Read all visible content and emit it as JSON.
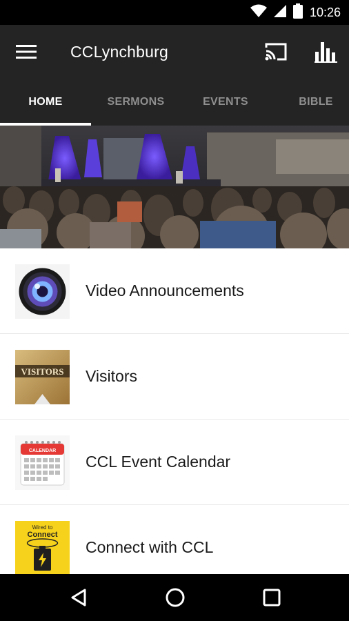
{
  "status_bar": {
    "time": "10:26"
  },
  "app_bar": {
    "title": "CCLynchburg"
  },
  "tabs": [
    {
      "label": "HOME",
      "active": true
    },
    {
      "label": "SERMONS",
      "active": false
    },
    {
      "label": "EVENTS",
      "active": false
    },
    {
      "label": "BIBLE",
      "active": false
    }
  ],
  "list": {
    "items": [
      {
        "label": "Video Announcements",
        "icon": "camera-lens-icon"
      },
      {
        "label": "Visitors",
        "icon": "visitors-banner-icon"
      },
      {
        "label": "CCL Event Calendar",
        "icon": "calendar-icon"
      },
      {
        "label": "Connect with CCL",
        "icon": "wired-to-connect-icon"
      }
    ]
  },
  "thumbs": {
    "visitors_text": "VISITORS",
    "calendar_text": "CALENDAR",
    "connect_line1": "Wired to",
    "connect_line2": "Connect"
  },
  "colors": {
    "app_bar": "#242424",
    "status_bar": "#000000",
    "tab_inactive": "#8f8f8f",
    "tab_active": "#ffffff",
    "calendar_red": "#e53935",
    "connect_yellow": "#f7d21c"
  }
}
